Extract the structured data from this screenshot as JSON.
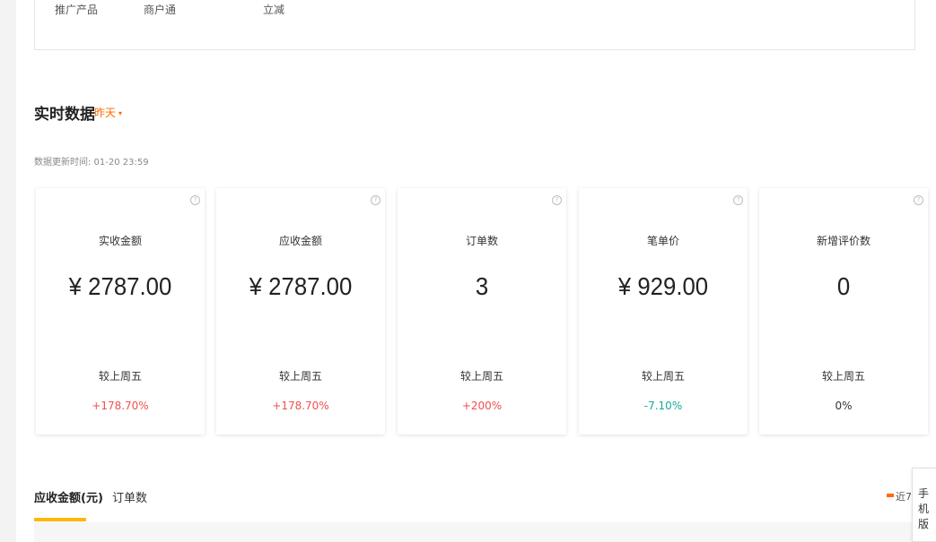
{
  "promo": {
    "items": [
      "推广产品",
      "商户通",
      "立减"
    ]
  },
  "realtime": {
    "title": "实时数据",
    "date_label": "昨天",
    "caret": "▾",
    "update_time": "数据更新时间: 01-20 23:59"
  },
  "cards": [
    {
      "label": "实收金额",
      "value": "¥ 2787.00",
      "compare_label": "较上周五",
      "compare_value": "+178.70%",
      "trend": "up"
    },
    {
      "label": "应收金额",
      "value": "¥ 2787.00",
      "compare_label": "较上周五",
      "compare_value": "+178.70%",
      "trend": "up"
    },
    {
      "label": "订单数",
      "value": "3",
      "compare_label": "较上周五",
      "compare_value": "+200%",
      "trend": "up"
    },
    {
      "label": "笔单价",
      "value": "¥ 929.00",
      "compare_label": "较上周五",
      "compare_value": "-7.10%",
      "trend": "down"
    },
    {
      "label": "新增评价数",
      "value": "0",
      "compare_label": "较上周五",
      "compare_value": "0%",
      "trend": "flat"
    }
  ],
  "help_glyph": "?",
  "chart_tabs": {
    "items": [
      "应收金额(元)",
      "订单数"
    ],
    "active_index": 0
  },
  "range_legend": "近7",
  "mobile_tab": "手机版",
  "colors": {
    "accent_orange": "#ff6a00",
    "tab_underline": "#ffb800",
    "up": "#f05050",
    "down": "#19a89a"
  }
}
